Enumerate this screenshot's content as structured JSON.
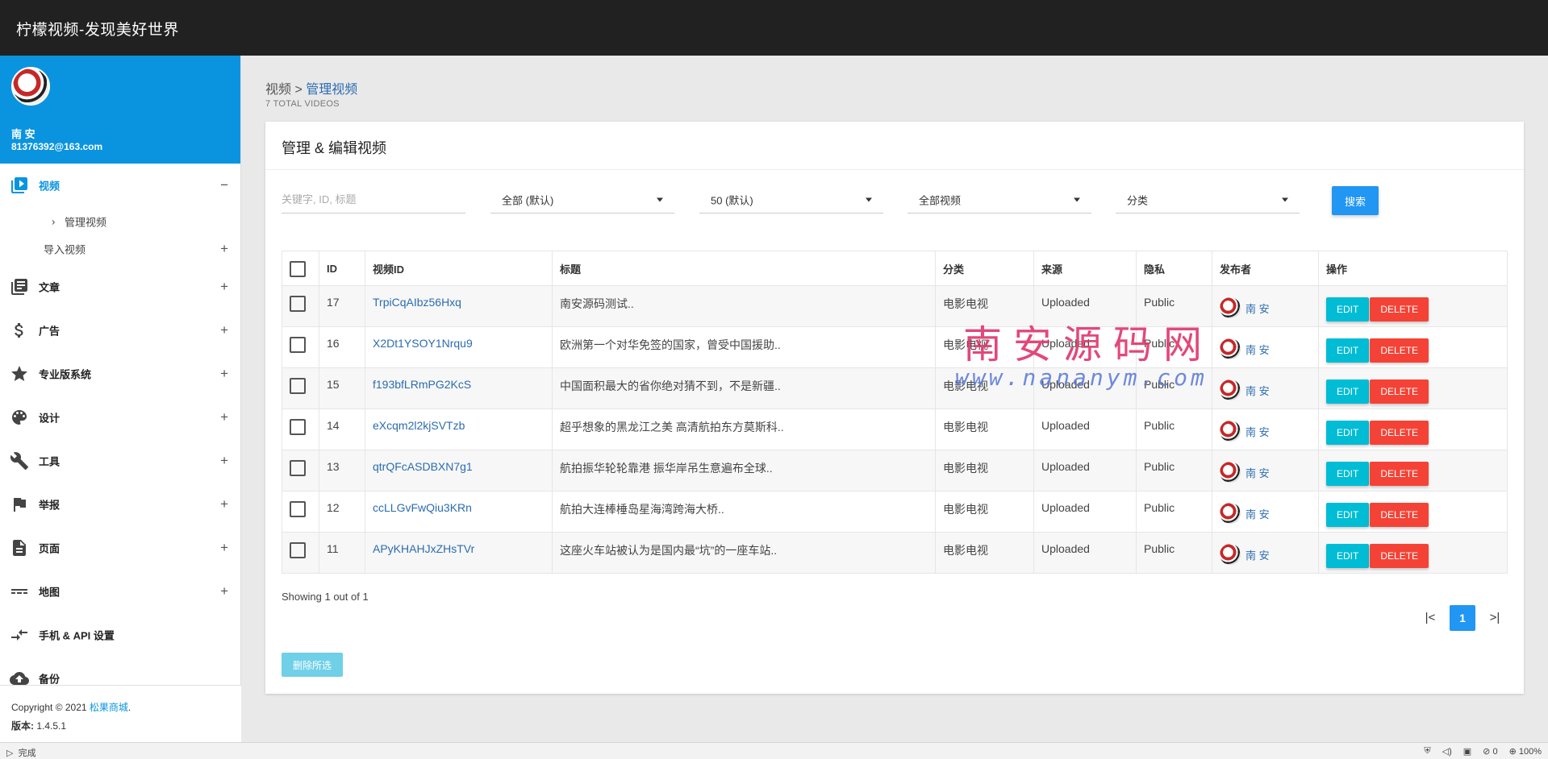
{
  "app": {
    "title": "柠檬视频-发现美好世界"
  },
  "user": {
    "name": "南 安",
    "email": "81376392@163.com"
  },
  "sidebar": {
    "items": [
      {
        "label": "视频",
        "toggle": "−",
        "icon": "video-icon"
      },
      {
        "label": "文章",
        "toggle": "+",
        "icon": "article-icon"
      },
      {
        "label": "广告",
        "toggle": "+",
        "icon": "dollar-icon"
      },
      {
        "label": "专业版系统",
        "toggle": "+",
        "icon": "star-icon"
      },
      {
        "label": "设计",
        "toggle": "+",
        "icon": "palette-icon"
      },
      {
        "label": "工具",
        "toggle": "+",
        "icon": "wrench-icon"
      },
      {
        "label": "举报",
        "toggle": "+",
        "icon": "flag-icon"
      },
      {
        "label": "页面",
        "toggle": "+",
        "icon": "page-icon"
      },
      {
        "label": "地图",
        "toggle": "+",
        "icon": "map-icon"
      },
      {
        "label": "手机 & API 设置",
        "toggle": "",
        "icon": "api-icon"
      },
      {
        "label": "备份",
        "toggle": "",
        "icon": "cloud-upload-icon"
      }
    ],
    "sub_items": [
      {
        "label": "管理视频",
        "prefix": "›"
      },
      {
        "label": "导入视频",
        "toggle": "+"
      }
    ],
    "footer": {
      "copyright": "Copyright © 2021 ",
      "company": "松果商城",
      "dot": ".",
      "version_label": "版本:",
      "version": " 1.4.5.1"
    }
  },
  "breadcrumb": {
    "parent": "视频",
    "sep": " > ",
    "current": "管理视频"
  },
  "total": "7 TOTAL VIDEOS",
  "card": {
    "title": "管理 & 编辑视频"
  },
  "filters": {
    "search_placeholder": "关键字, ID, 标题",
    "select1": "全部 (默认)",
    "select2": "50 (默认)",
    "select3": "全部视频",
    "select4": "分类",
    "search_button": "搜索"
  },
  "table": {
    "headers": [
      "ID",
      "视频ID",
      "标题",
      "分类",
      "来源",
      "隐私",
      "发布者",
      "操作"
    ],
    "rows": [
      {
        "id": "17",
        "vid": "TrpiCqAIbz56Hxq",
        "title": "南安源码测试..",
        "category": "电影电视",
        "source": "Uploaded",
        "privacy": "Public",
        "publisher": "南 安"
      },
      {
        "id": "16",
        "vid": "X2Dt1YSOY1Nrqu9",
        "title": "欧洲第一个对华免签的国家，曾受中国援助..",
        "category": "电影电视",
        "source": "Uploaded",
        "privacy": "Public",
        "publisher": "南 安"
      },
      {
        "id": "15",
        "vid": "f193bfLRmPG2KcS",
        "title": "中国面积最大的省你绝对猜不到，不是新疆..",
        "category": "电影电视",
        "source": "Uploaded",
        "privacy": "Public",
        "publisher": "南 安"
      },
      {
        "id": "14",
        "vid": "eXcqm2l2kjSVTzb",
        "title": "超乎想象的黑龙江之美 高清航拍东方莫斯科..",
        "category": "电影电视",
        "source": "Uploaded",
        "privacy": "Public",
        "publisher": "南 安"
      },
      {
        "id": "13",
        "vid": "qtrQFcASDBXN7g1",
        "title": "航拍振华轮轮靠港 振华岸吊生意遍布全球..",
        "category": "电影电视",
        "source": "Uploaded",
        "privacy": "Public",
        "publisher": "南 安"
      },
      {
        "id": "12",
        "vid": "ccLLGvFwQiu3KRn",
        "title": "航拍大连棒棰岛星海湾跨海大桥..",
        "category": "电影电视",
        "source": "Uploaded",
        "privacy": "Public",
        "publisher": "南 安"
      },
      {
        "id": "11",
        "vid": "APyKHAHJxZHsTVr",
        "title": "这座火车站被认为是国内最“坑”的一座车站..",
        "category": "电影电视",
        "source": "Uploaded",
        "privacy": "Public",
        "publisher": "南 安"
      }
    ],
    "edit_label": "EDIT",
    "delete_label": "DELETE"
  },
  "showing": "Showing 1 out of 1",
  "pagination": {
    "first": "|<",
    "current": "1",
    "last": ">|"
  },
  "delete_selected": "删除所选",
  "watermark": {
    "line1": "南安源码网",
    "line2": "www.nananym.com"
  },
  "statusbar": {
    "status": "完成",
    "count": "0",
    "zoom": "100%"
  },
  "colors": {
    "accent": "#0a94e0",
    "edit": "#00bcd4",
    "delete": "#f44336",
    "topbar": "#212121"
  }
}
